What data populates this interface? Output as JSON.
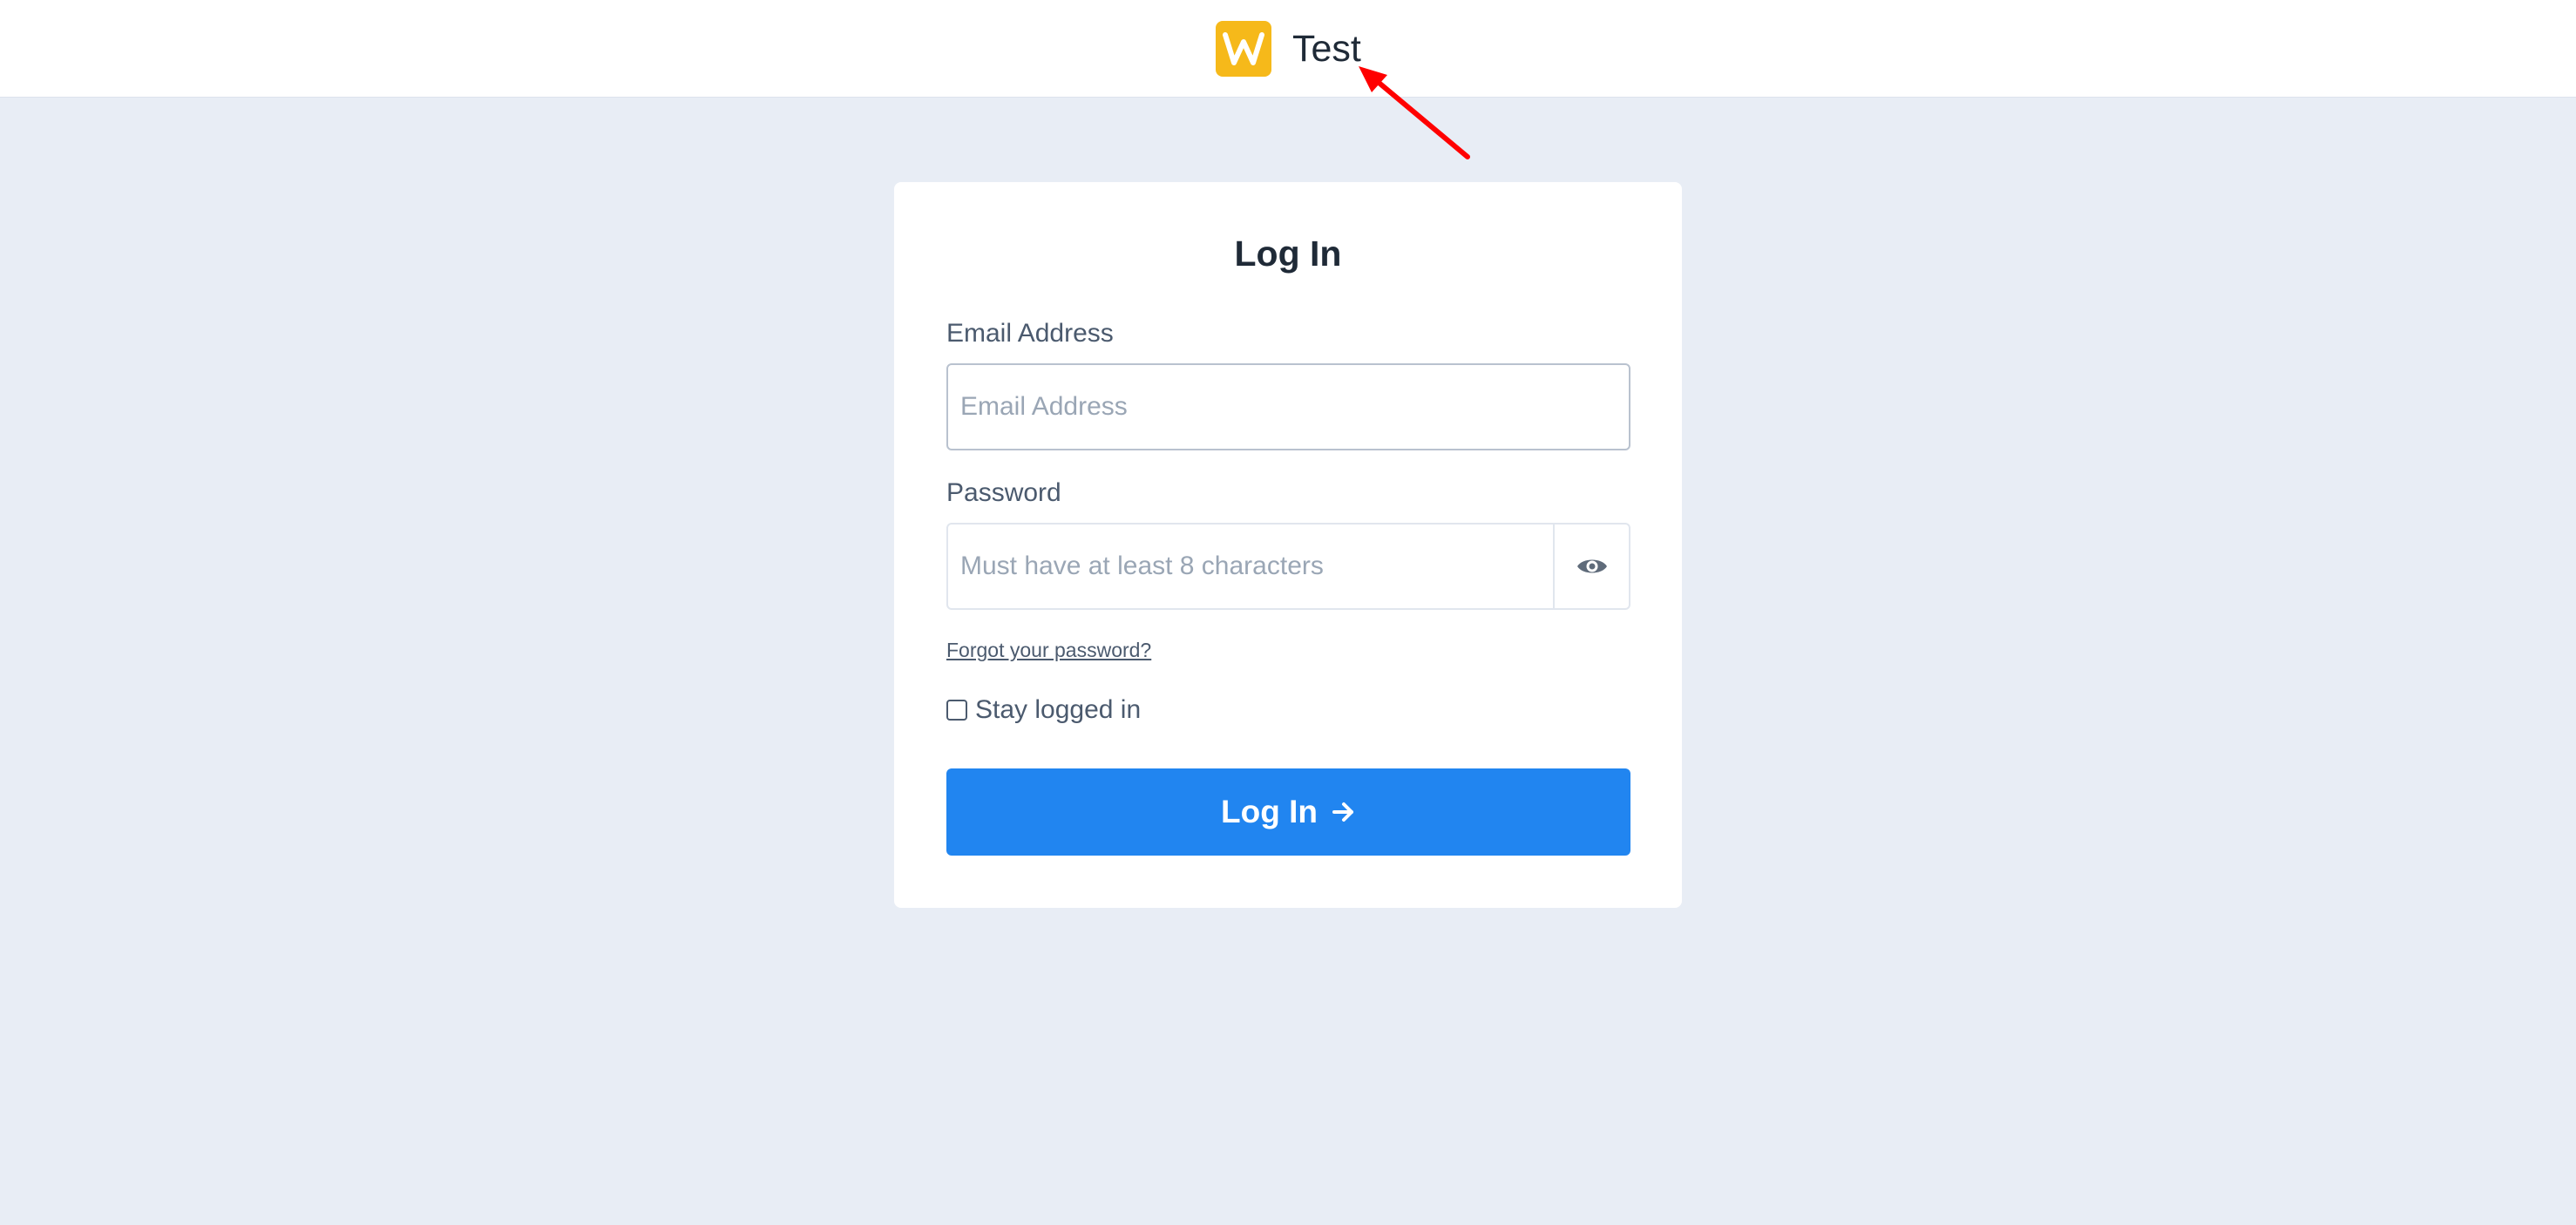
{
  "header": {
    "brand_name": "Test",
    "logo_letter": "W",
    "logo_color": "#f6b91a"
  },
  "login_card": {
    "title": "Log In",
    "email": {
      "label": "Email Address",
      "placeholder": "Email Address",
      "value": ""
    },
    "password": {
      "label": "Password",
      "placeholder": "Must have at least 8 characters",
      "value": "",
      "toggle_icon": "eye-icon"
    },
    "forgot_password_link": "Forgot your password?",
    "stay_logged_in": {
      "label": "Stay logged in",
      "checked": false
    },
    "submit_button": {
      "label": "Log In",
      "icon": "arrow-right-icon",
      "color": "#2185f0"
    }
  },
  "annotation": {
    "type": "arrow",
    "color": "#ff0000",
    "points_to": "brand-name"
  }
}
